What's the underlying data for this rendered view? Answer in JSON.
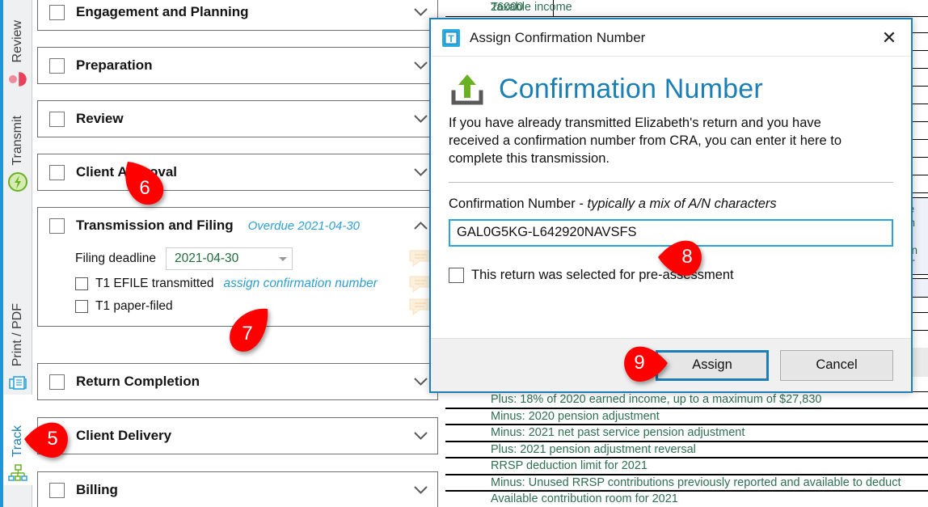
{
  "rail": {
    "tabs": [
      {
        "label": "Review",
        "icon": "review-icon",
        "active": false
      },
      {
        "label": "Transmit",
        "icon": "transmit-icon",
        "active": false
      },
      {
        "label": "Print / PDF",
        "icon": "print-pdf-icon",
        "active": false
      },
      {
        "label": "Track",
        "icon": "track-icon",
        "active": true
      }
    ]
  },
  "checklist": {
    "groups": [
      {
        "title": "Engagement and Planning",
        "status": "",
        "expanded": false
      },
      {
        "title": "Preparation",
        "status": "",
        "expanded": false
      },
      {
        "title": "Review",
        "status": "",
        "expanded": false
      },
      {
        "title": "Client Approval",
        "status": "",
        "expanded": false
      },
      {
        "title": "Transmission and Filing",
        "status": "Overdue 2021-04-30",
        "expanded": true,
        "deadline_label": "Filing deadline",
        "deadline_value": "2021-04-30",
        "items": [
          {
            "label": "T1 EFILE transmitted",
            "link": "assign confirmation number",
            "checked": false
          },
          {
            "label": "T1 paper-filed",
            "link": "",
            "checked": false
          }
        ]
      },
      {
        "title": "Return Completion",
        "status": "",
        "expanded": false
      },
      {
        "title": "Client Delivery",
        "status": "",
        "expanded": false
      },
      {
        "title": "Billing",
        "status": "",
        "expanded": false
      }
    ]
  },
  "dialog": {
    "app_icon": "taxcycle-icon",
    "title": "Assign Confirmation Number",
    "close_label": "✕",
    "heading_icon": "upload-icon",
    "heading": "Confirmation Number",
    "description": "If you have already transmitted Elizabeth's return and you have received a confirmation number from CRA, you can enter it here to complete this transmission.",
    "field_label_plain": "Confirmation Number - ",
    "field_label_italic": "typically a mix of A/N characters",
    "confirmation_number": "GAL0G5KG-L642920NAVSFS",
    "confirmation_placeholder": "",
    "preassessment_label": "This return was selected for pre-assessment",
    "preassessment_checked": false,
    "assign_label": "Assign",
    "cancel_label": "Cancel"
  },
  "callouts": [
    {
      "number": "5"
    },
    {
      "number": "6"
    },
    {
      "number": "7"
    },
    {
      "number": "8"
    },
    {
      "number": "9"
    }
  ],
  "sheet": {
    "top_row": {
      "num": "26000",
      "text": "Taxable income"
    },
    "bottom_rows": [
      "Plus: 18% of 2020 earned income, up to a maximum of $27,830",
      "Minus: 2020 pension adjustment",
      "Minus: 2021 net past service pension adjustment",
      "Plus: 2021 pension adjustment reversal",
      "RRSP deduction limit for 2021",
      "Minus: Unused RRSP contributions previously reported and available to deduct",
      "Available contribution room for 2021"
    ]
  },
  "colors": {
    "accent": "#1b7fb5",
    "link": "#2f9fd0",
    "callout": "#ff0000",
    "sheet_text": "#2f6f53",
    "upload_arrow": "#6ab023"
  }
}
